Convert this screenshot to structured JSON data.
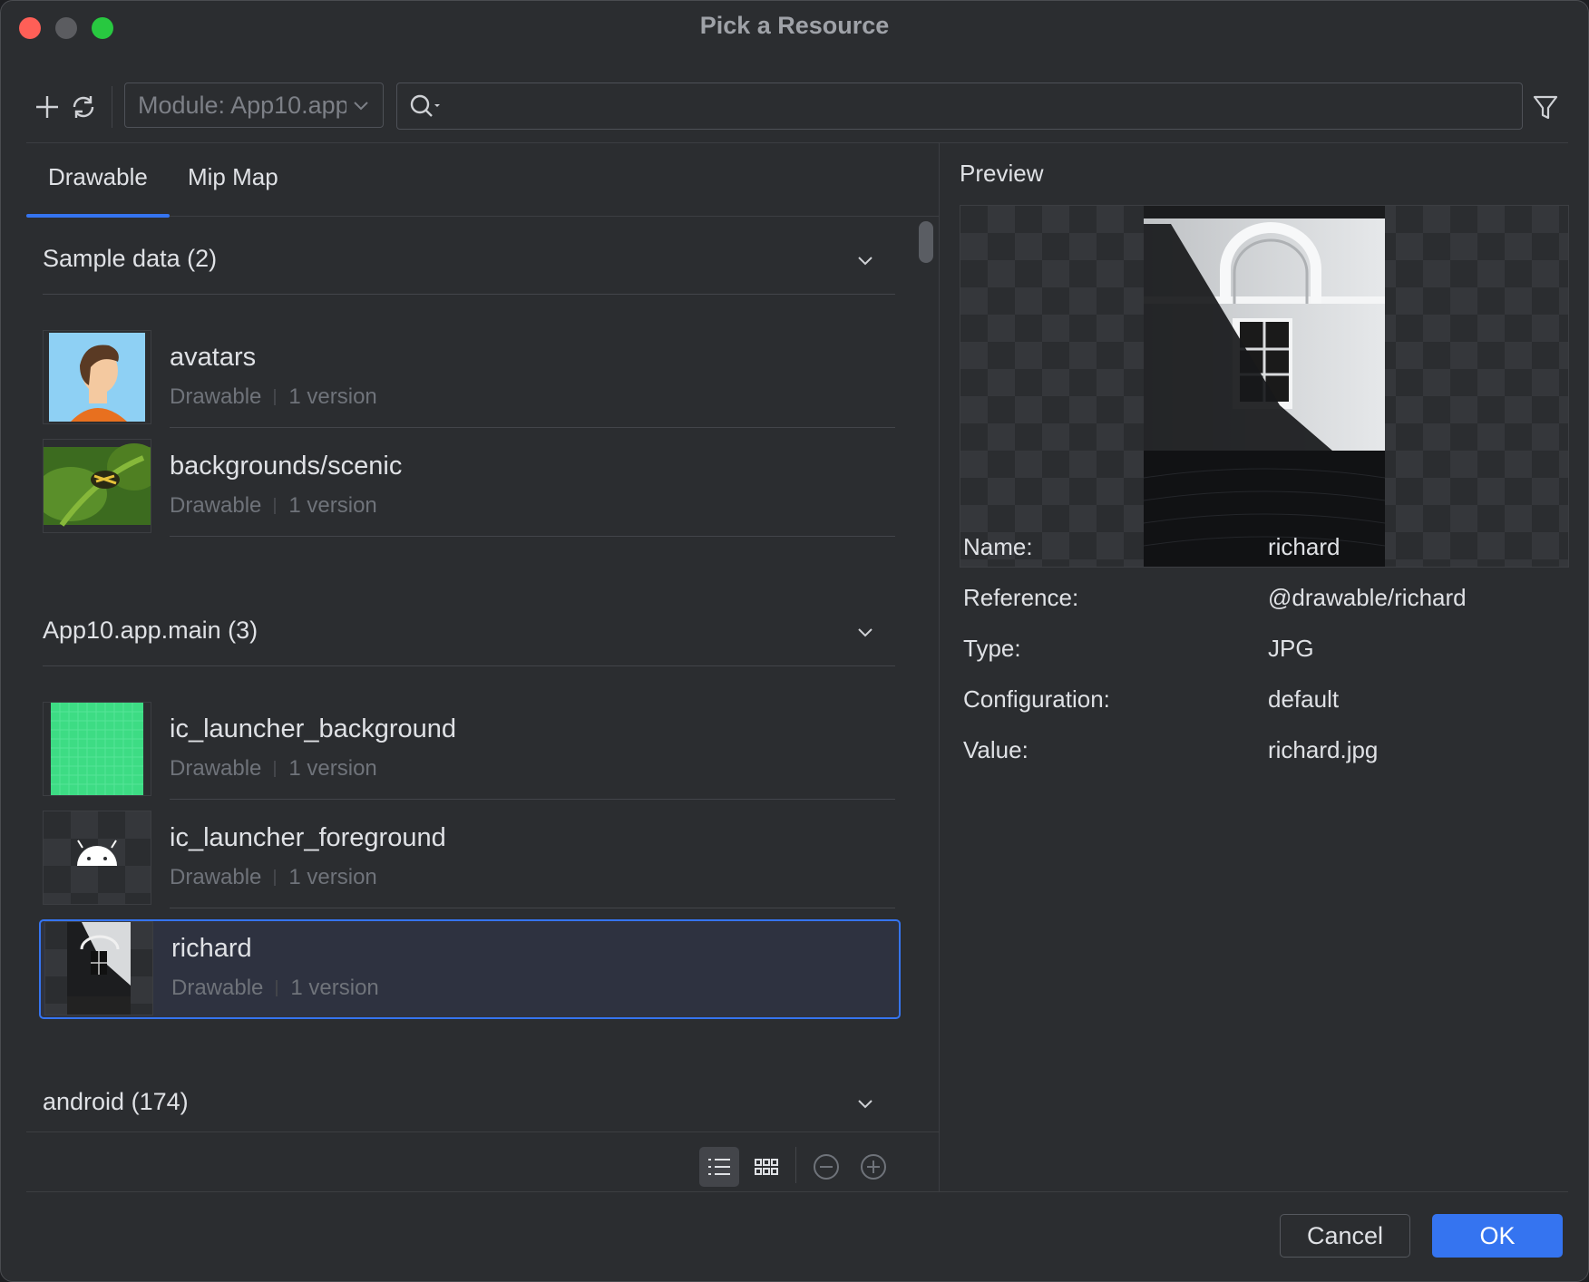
{
  "window": {
    "title": "Pick a Resource"
  },
  "toolbar": {
    "module_label": "Module: App10.app",
    "search_placeholder": ""
  },
  "tabs": [
    {
      "label": "Drawable",
      "active": true
    },
    {
      "label": "Mip Map",
      "active": false
    }
  ],
  "groups": [
    {
      "title": "Sample data (2)",
      "items": [
        {
          "name": "avatars",
          "type": "Drawable",
          "versions": "1 version"
        },
        {
          "name": "backgrounds/scenic",
          "type": "Drawable",
          "versions": "1 version"
        }
      ]
    },
    {
      "title": "App10.app.main (3)",
      "items": [
        {
          "name": "ic_launcher_background",
          "type": "Drawable",
          "versions": "1 version"
        },
        {
          "name": "ic_launcher_foreground",
          "type": "Drawable",
          "versions": "1 version"
        },
        {
          "name": "richard",
          "type": "Drawable",
          "versions": "1 version",
          "selected": true
        }
      ]
    },
    {
      "title": "android (174)",
      "items": []
    }
  ],
  "preview": {
    "title": "Preview",
    "properties": [
      {
        "key": "Name:",
        "value": "richard"
      },
      {
        "key": "Reference:",
        "value": "@drawable/richard"
      },
      {
        "key": "Type:",
        "value": "JPG"
      },
      {
        "key": "Configuration:",
        "value": "default"
      },
      {
        "key": "Value:",
        "value": "richard.jpg"
      }
    ]
  },
  "footer": {
    "cancel_label": "Cancel",
    "ok_label": "OK"
  },
  "colors": {
    "accent": "#3574f0",
    "background": "#2b2d30",
    "close": "#fe5f57",
    "maximize": "#28c840"
  }
}
